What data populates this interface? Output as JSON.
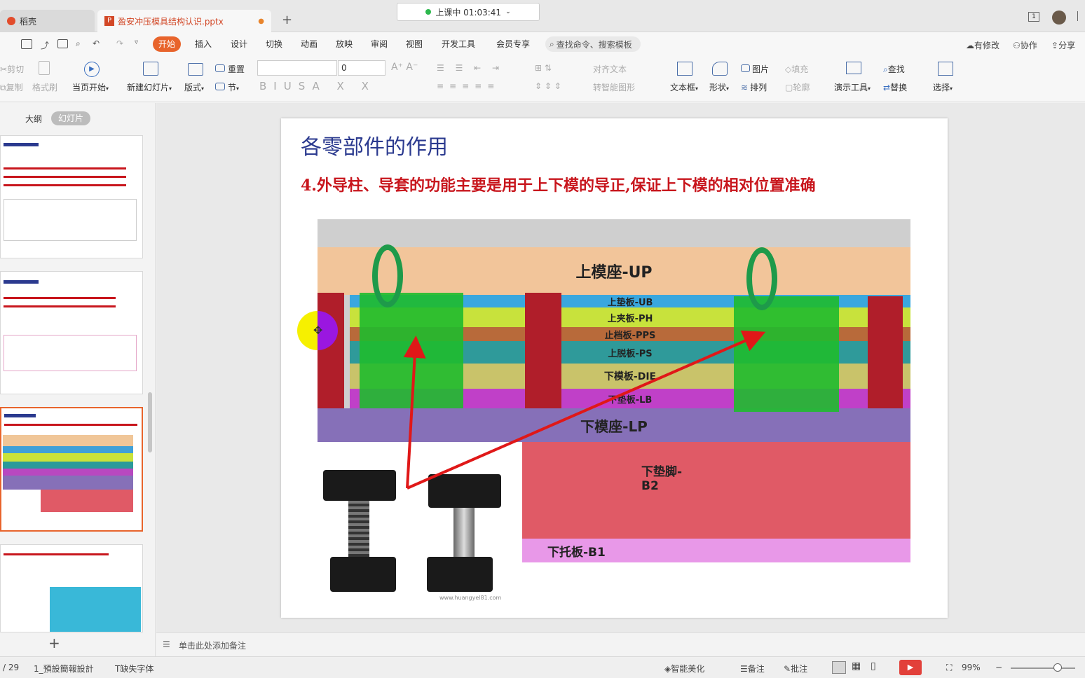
{
  "window": {
    "tab_home": "稻壳",
    "tab_doc": "盈安冲压模具结构认识.pptx",
    "recording": "上课中 01:03:41",
    "page_indicator": "1"
  },
  "menu": {
    "items": [
      "开始",
      "插入",
      "设计",
      "切换",
      "动画",
      "放映",
      "审阅",
      "视图",
      "开发工具",
      "会员专享"
    ],
    "search": "查找命令、搜索模板",
    "right": [
      "有修改",
      "协作",
      "分享"
    ]
  },
  "ribbon": {
    "cut": "剪切",
    "copy": "复制",
    "format_painter": "格式刷",
    "from_current": "当页开始",
    "new_slide": "新建幻灯片",
    "layout": "版式",
    "reset": "重置",
    "section": "节",
    "font_size": "0",
    "align_text": "对齐文本",
    "smart_shape": "转智能图形",
    "textbox": "文本框",
    "shape": "形状",
    "picture": "图片",
    "arrange": "排列",
    "fill": "填充",
    "outline": "轮廓",
    "present_tools": "演示工具",
    "find": "查找",
    "replace": "替换",
    "select": "选择"
  },
  "panel": {
    "outline_tab": "大纲",
    "slides_tab": "幻灯片"
  },
  "slide": {
    "title": "各零部件的作用",
    "subtitle": "4.外导柱、导套的功能主要是用于上下模的导正,保证上下模的相对位置准确",
    "layers": [
      "上模座-UP",
      "上垫板-UB",
      "上夹板-PH",
      "止档板-PPS",
      "上脱板-PS",
      "下模板-DIE",
      "下垫板-LB",
      "下模座-LP",
      "下垫脚-B2",
      "下托板-B1"
    ],
    "watermark": "www.huangyel81.com"
  },
  "notes": {
    "placeholder": "单击此处添加备注"
  },
  "status": {
    "page": "/ 29",
    "theme": "1_預設簡報設計",
    "missing_font": "缺失字体",
    "beautify": "智能美化",
    "notes": "备注",
    "comment": "批注",
    "zoom": "99%"
  },
  "colors": {
    "accent": "#e8642c",
    "title_blue": "#2b3a8f",
    "subtitle_red": "#c8161d",
    "selected_thumb": "#e8642c"
  }
}
